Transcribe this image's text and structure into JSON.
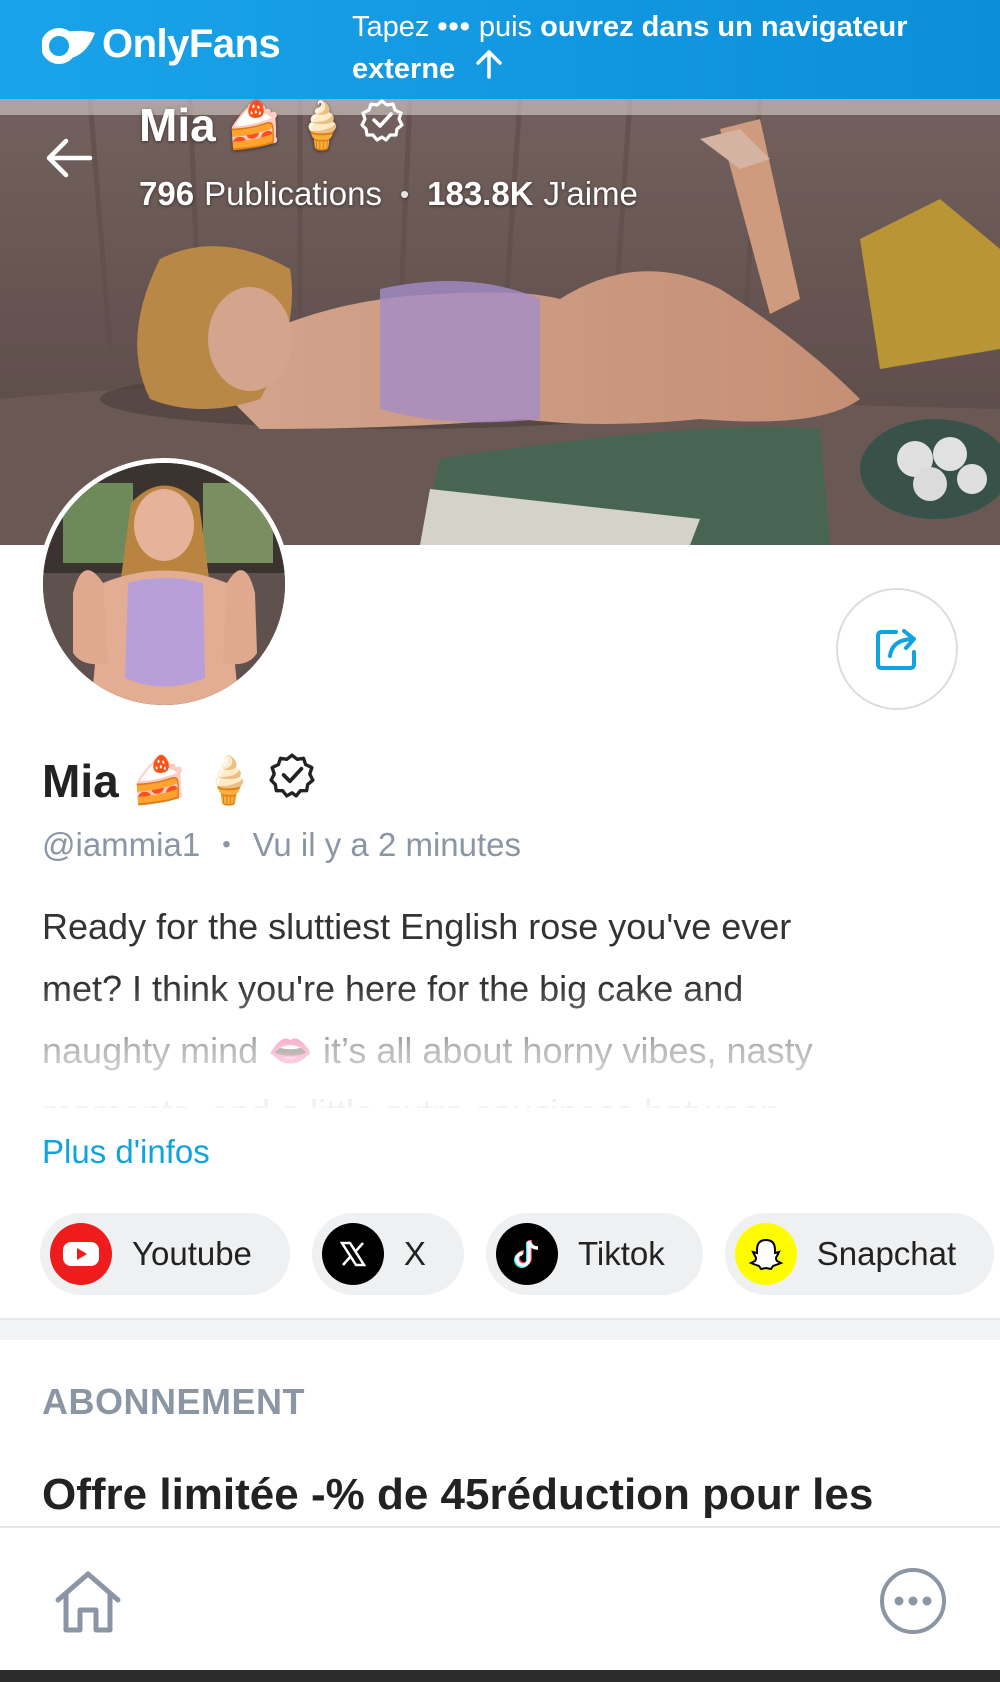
{
  "banner": {
    "brand_name": "OnlyFans",
    "instruction_start": "Tapez",
    "instruction_dots": "•••",
    "instruction_middle": "puis",
    "instruction_bold": "ouvrez dans un navigateur externe"
  },
  "cover": {
    "name": "Mia",
    "emoji_cake": "🍰",
    "emoji_icecream": "🍦",
    "posts_count": "796",
    "posts_label": "Publications",
    "separator": "•",
    "likes_count": "183.8K",
    "likes_label": "J'aime"
  },
  "profile": {
    "name": "Mia",
    "emoji_cake": "🍰",
    "emoji_icecream": "🍦",
    "handle": "@iammia1",
    "separator": "•",
    "last_seen": "Vu  il y a 2 minutes",
    "bio_line1": "Ready for the sluttiest English rose you've ever",
    "bio_line2": "met? I think you're here for the big cake and",
    "bio_line3": "naughty mind 👄 it’s all about horny vibes, nasty",
    "bio_line4": "moments, and a little extra sauciness between",
    "more_info": "Plus d'infos"
  },
  "socials": [
    {
      "label": "Youtube",
      "icon": "youtube-icon",
      "color": "#ee1c1c"
    },
    {
      "label": "X",
      "icon": "x-icon",
      "color": "#000000"
    },
    {
      "label": "Tiktok",
      "icon": "tiktok-icon",
      "color": "#000000"
    },
    {
      "label": "Snapchat",
      "icon": "snapchat-icon",
      "color": "#fffc00"
    }
  ],
  "subscription": {
    "section_title": "ABONNEMENT",
    "offer_title": "Offre limitée -% de 45réduction pour les"
  },
  "colors": {
    "accent": "#0fa3e0",
    "muted": "#8a96a3"
  }
}
